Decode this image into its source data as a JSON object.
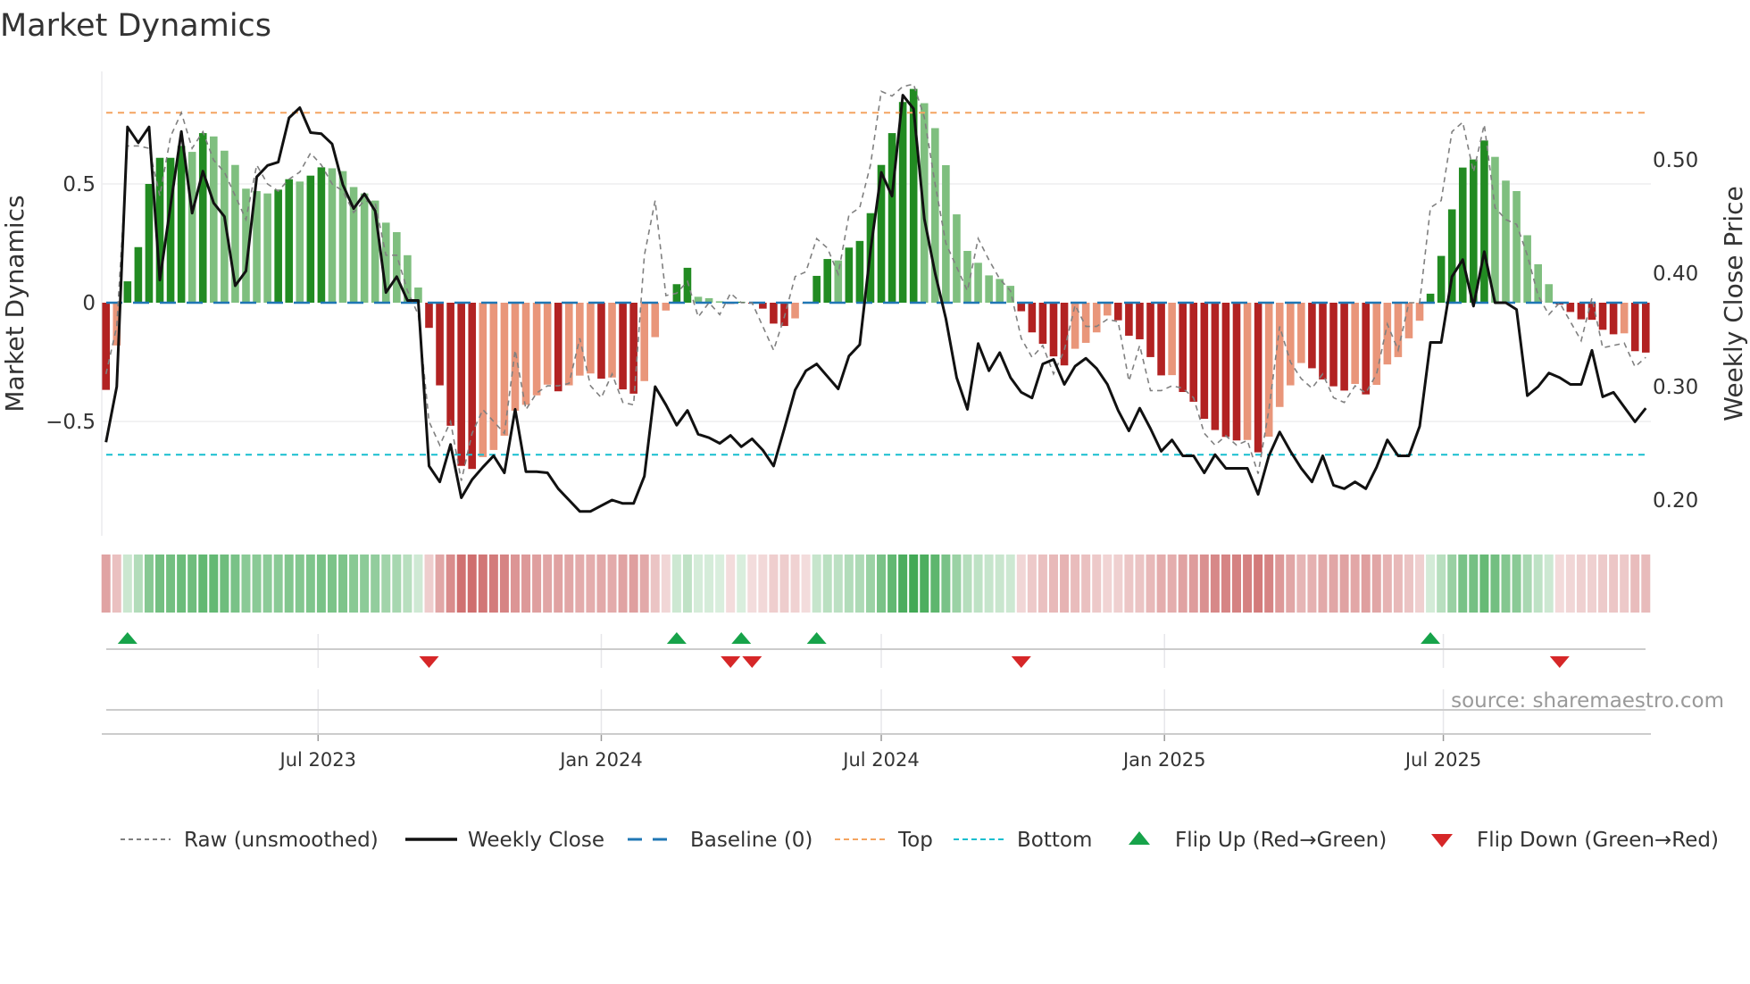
{
  "chart_data": {
    "type": "bar",
    "title": "Market Dynamics",
    "ylabel": "Market Dynamics",
    "y2label": "Weekly Close Price",
    "source": "source: sharemaestro.com",
    "ylim": [
      -0.98,
      0.9
    ],
    "y2lim": [
      0.168,
      0.56
    ],
    "yticks": [
      {
        "v": 0.5,
        "label": "0.5"
      },
      {
        "v": 0,
        "label": "0"
      },
      {
        "v": -0.5,
        "label": "−0.5"
      }
    ],
    "y2ticks": [
      {
        "v": 0.5,
        "label": "0.50"
      },
      {
        "v": 0.4,
        "label": "0.40"
      },
      {
        "v": 0.3,
        "label": "0.30"
      },
      {
        "v": 0.2,
        "label": "0.20"
      }
    ],
    "xticks": [
      {
        "week": 20.7,
        "label": "Jul 2023"
      },
      {
        "week": 47.0,
        "label": "Jan 2024"
      },
      {
        "week": 73.0,
        "label": "Jul 2024"
      },
      {
        "week": 99.3,
        "label": "Jan 2025"
      },
      {
        "week": 125.2,
        "label": "Jul 2025"
      }
    ],
    "levels": {
      "baseline": 0,
      "top": 0.8,
      "bottom": -0.64
    },
    "colors": {
      "up_strong": "#228b22",
      "up_weak": "#7fbf7f",
      "down_strong": "#b22222",
      "down_weak": "#e9967a",
      "raw": "#808080",
      "close": "#111111",
      "baseline": "#1f77b4",
      "top": "#f4a460",
      "bottom": "#17becf",
      "flip_up": "#17a34a",
      "flip_down": "#d62728"
    },
    "dynamics": [
      -0.367,
      -0.18,
      0.09,
      0.234,
      0.5,
      0.61,
      0.61,
      0.66,
      0.635,
      0.714,
      0.7,
      0.64,
      0.58,
      0.48,
      0.47,
      0.46,
      0.476,
      0.52,
      0.51,
      0.535,
      0.57,
      0.566,
      0.554,
      0.487,
      0.46,
      0.43,
      0.337,
      0.297,
      0.2,
      0.064,
      -0.106,
      -0.348,
      -0.518,
      -0.687,
      -0.7,
      -0.65,
      -0.62,
      -0.56,
      -0.455,
      -0.43,
      -0.39,
      -0.345,
      -0.373,
      -0.348,
      -0.307,
      -0.298,
      -0.32,
      -0.315,
      -0.365,
      -0.383,
      -0.33,
      -0.145,
      -0.033,
      0.078,
      0.147,
      0.025,
      0.019,
      0.006,
      -0.005,
      0.004,
      -0.004,
      -0.025,
      -0.088,
      -0.098,
      -0.066,
      -0.004,
      0.113,
      0.184,
      0.178,
      0.232,
      0.26,
      0.377,
      0.58,
      0.714,
      0.845,
      0.9,
      0.84,
      0.735,
      0.579,
      0.372,
      0.218,
      0.168,
      0.115,
      0.1,
      0.071,
      -0.036,
      -0.125,
      -0.173,
      -0.226,
      -0.264,
      -0.194,
      -0.169,
      -0.125,
      -0.054,
      -0.074,
      -0.139,
      -0.154,
      -0.229,
      -0.306,
      -0.305,
      -0.376,
      -0.417,
      -0.489,
      -0.536,
      -0.565,
      -0.58,
      -0.578,
      -0.63,
      -0.564,
      -0.439,
      -0.348,
      -0.254,
      -0.276,
      -0.323,
      -0.352,
      -0.37,
      -0.342,
      -0.386,
      -0.346,
      -0.26,
      -0.229,
      -0.15,
      -0.076,
      0.038,
      0.197,
      0.393,
      0.569,
      0.603,
      0.683,
      0.614,
      0.514,
      0.47,
      0.284,
      0.162,
      0.078,
      -0.008,
      -0.039,
      -0.07,
      -0.072,
      -0.114,
      -0.133,
      -0.129,
      -0.204,
      -0.21
    ],
    "raw": [
      -0.3,
      -0.1,
      0.66,
      0.66,
      0.65,
      0.45,
      0.7,
      0.8,
      0.65,
      0.72,
      0.6,
      0.55,
      0.45,
      0.35,
      0.58,
      0.5,
      0.47,
      0.52,
      0.55,
      0.63,
      0.58,
      0.5,
      0.47,
      0.38,
      0.43,
      0.42,
      0.2,
      0.2,
      0.05,
      -0.05,
      -0.5,
      -0.6,
      -0.5,
      -0.75,
      -0.55,
      -0.45,
      -0.5,
      -0.55,
      -0.2,
      -0.45,
      -0.38,
      -0.35,
      -0.35,
      -0.34,
      -0.15,
      -0.35,
      -0.4,
      -0.3,
      -0.42,
      -0.43,
      0.2,
      0.43,
      0.03,
      0.04,
      0.09,
      -0.06,
      0.0,
      -0.05,
      0.04,
      0.0,
      0.0,
      -0.1,
      -0.2,
      -0.06,
      0.11,
      0.13,
      0.27,
      0.23,
      0.12,
      0.37,
      0.4,
      0.58,
      0.89,
      0.87,
      0.91,
      0.92,
      0.78,
      0.5,
      0.25,
      0.15,
      0.05,
      0.27,
      0.18,
      0.1,
      0.05,
      -0.15,
      -0.23,
      -0.18,
      -0.3,
      -0.2,
      -0.01,
      -0.1,
      -0.1,
      -0.07,
      -0.08,
      -0.33,
      -0.18,
      -0.37,
      -0.37,
      -0.35,
      -0.36,
      -0.4,
      -0.55,
      -0.6,
      -0.56,
      -0.6,
      -0.58,
      -0.72,
      -0.45,
      -0.1,
      -0.25,
      -0.32,
      -0.36,
      -0.3,
      -0.4,
      -0.42,
      -0.35,
      -0.38,
      -0.3,
      -0.09,
      -0.2,
      0.0,
      0.0,
      0.4,
      0.43,
      0.72,
      0.76,
      0.55,
      0.75,
      0.4,
      0.35,
      0.33,
      0.2,
      0.03,
      -0.05,
      0.0,
      -0.08,
      -0.16,
      0.02,
      -0.19,
      -0.18,
      -0.17,
      -0.27,
      -0.23
    ],
    "close": [
      0.251,
      0.3,
      0.529,
      0.515,
      0.529,
      0.394,
      0.46,
      0.525,
      0.453,
      0.49,
      0.462,
      0.45,
      0.389,
      0.402,
      0.485,
      0.495,
      0.498,
      0.537,
      0.546,
      0.524,
      0.523,
      0.514,
      0.478,
      0.457,
      0.47,
      0.455,
      0.383,
      0.397,
      0.376,
      0.376,
      0.23,
      0.216,
      0.249,
      0.202,
      0.218,
      0.229,
      0.239,
      0.224,
      0.28,
      0.225,
      0.225,
      0.224,
      0.21,
      0.2,
      0.19,
      0.19,
      0.195,
      0.2,
      0.197,
      0.197,
      0.221,
      0.3,
      0.284,
      0.266,
      0.279,
      0.258,
      0.255,
      0.25,
      0.257,
      0.247,
      0.254,
      0.244,
      0.23,
      0.263,
      0.297,
      0.314,
      0.32,
      0.309,
      0.298,
      0.327,
      0.337,
      0.42,
      0.489,
      0.468,
      0.557,
      0.545,
      0.448,
      0.4,
      0.36,
      0.308,
      0.28,
      0.338,
      0.314,
      0.33,
      0.308,
      0.295,
      0.29,
      0.32,
      0.324,
      0.302,
      0.318,
      0.325,
      0.316,
      0.302,
      0.279,
      0.261,
      0.281,
      0.263,
      0.243,
      0.253,
      0.239,
      0.239,
      0.224,
      0.24,
      0.228,
      0.228,
      0.228,
      0.205,
      0.239,
      0.26,
      0.243,
      0.228,
      0.216,
      0.239,
      0.213,
      0.21,
      0.216,
      0.21,
      0.229,
      0.253,
      0.239,
      0.239,
      0.265,
      0.339,
      0.339,
      0.397,
      0.412,
      0.371,
      0.419,
      0.374,
      0.374,
      0.368,
      0.292,
      0.3,
      0.312,
      0.308,
      0.302,
      0.302,
      0.332,
      0.291,
      0.295,
      0.282,
      0.269,
      0.281
    ],
    "flip_up_weeks": [
      3,
      54,
      60,
      67,
      124
    ],
    "flip_down_weeks": [
      31,
      59,
      61,
      86,
      136
    ],
    "legend": {
      "placement": "bottom",
      "items": [
        {
          "key": "raw",
          "label": "Raw (unsmoothed)"
        },
        {
          "key": "close",
          "label": "Weekly Close"
        },
        {
          "key": "baseline",
          "label": "Baseline (0)"
        },
        {
          "key": "top",
          "label": "Top"
        },
        {
          "key": "bottom",
          "label": "Bottom"
        },
        {
          "key": "flip_up",
          "label": "Flip Up (Red→Green)"
        },
        {
          "key": "flip_down",
          "label": "Flip Down (Green→Red)"
        }
      ]
    }
  }
}
